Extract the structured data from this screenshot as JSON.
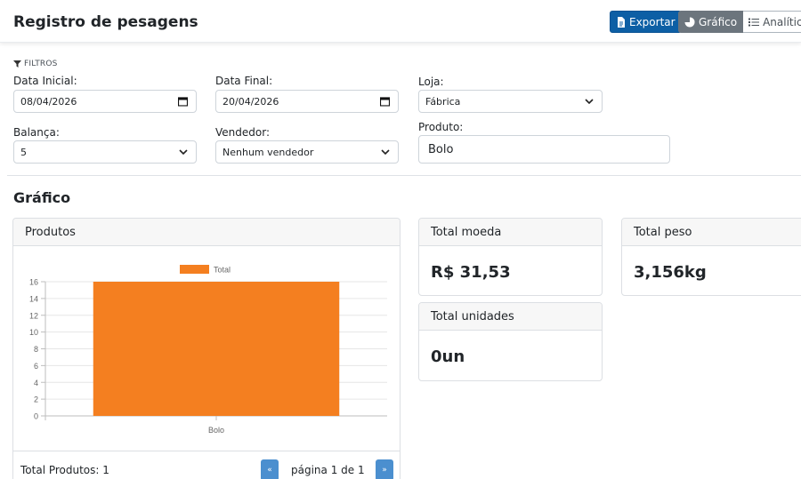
{
  "header": {
    "title": "Registro de pesagens",
    "export_label": "Exportar",
    "view_grafico": "Gráfico",
    "view_analitico": "Analítico"
  },
  "filters": {
    "title": "FILTROS",
    "data_inicial": {
      "label": "Data Inicial:",
      "value": "08/04/2026"
    },
    "data_final": {
      "label": "Data Final:",
      "value": "20/04/2026"
    },
    "loja": {
      "label": "Loja:",
      "value": "Fábrica"
    },
    "balanca": {
      "label": "Balança:",
      "value": "5"
    },
    "vendedor": {
      "label": "Vendedor:",
      "value": "Nenhum vendedor"
    },
    "produto": {
      "label": "Produto:",
      "value": "Bolo"
    }
  },
  "section_title": "Gráfico",
  "produtos_card": {
    "header": "Produtos",
    "total_label": "Total Produtos: 1",
    "prev": "«",
    "next": "»",
    "page_text": "página 1 de 1"
  },
  "chart_data": {
    "type": "bar",
    "categories": [
      "Bolo"
    ],
    "series": [
      {
        "name": "Total",
        "values": [
          16
        ],
        "color": "#f47f20"
      }
    ],
    "ylim": [
      0,
      16
    ],
    "yticks": [
      0,
      2,
      4,
      6,
      8,
      10,
      12,
      14,
      16
    ],
    "legend": "top",
    "grid": true
  },
  "totals": {
    "moeda": {
      "label": "Total moeda",
      "value": "R$ 31,53"
    },
    "peso": {
      "label": "Total peso",
      "value": "3,156kg"
    },
    "unidades": {
      "label": "Total unidades",
      "value": "0un"
    }
  },
  "colors": {
    "export_button": "#0d5fa5",
    "active_view": "#6c757d",
    "bar": "#f47f20",
    "pagination": "#4b8fcf"
  }
}
